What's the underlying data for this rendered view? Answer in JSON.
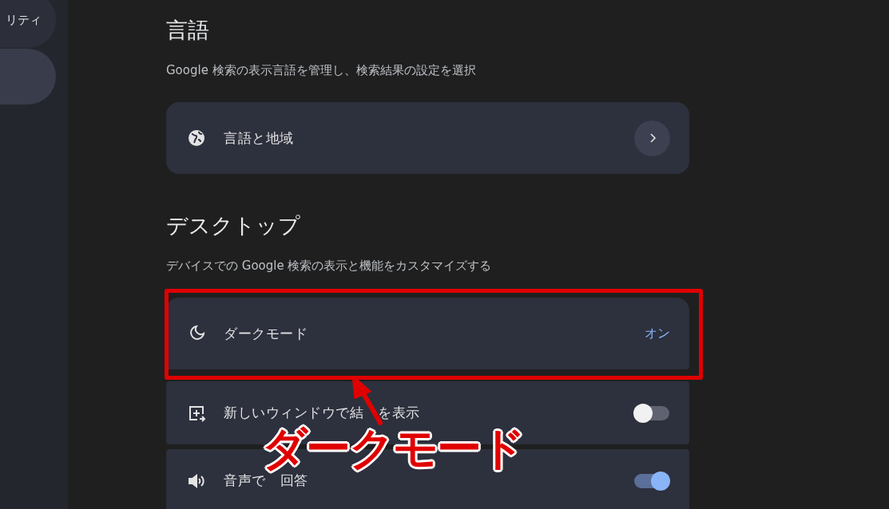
{
  "sidebar": {
    "items": [
      {
        "label": "リティ",
        "selected": false
      },
      {
        "selected": true
      }
    ]
  },
  "sections": [
    {
      "title": "言語",
      "description": "Google 検索の表示言語を管理し、検索結果の設定を選択",
      "rows": [
        {
          "kind": "link",
          "label": "言語と地域"
        }
      ]
    },
    {
      "title": "デスクトップ",
      "description": "デバイスでの Google 検索の表示と機能をカスタマイズする",
      "rows": [
        {
          "kind": "value",
          "label": "ダークモード",
          "value": "オン"
        },
        {
          "kind": "toggle",
          "label_parts": [
            "新しいウィンドウで結",
            "を表示"
          ],
          "on": false
        },
        {
          "kind": "toggle",
          "label_parts": [
            "音声で",
            "回答"
          ],
          "on": true
        }
      ]
    }
  ],
  "annotation": {
    "text": "ダークモード"
  }
}
